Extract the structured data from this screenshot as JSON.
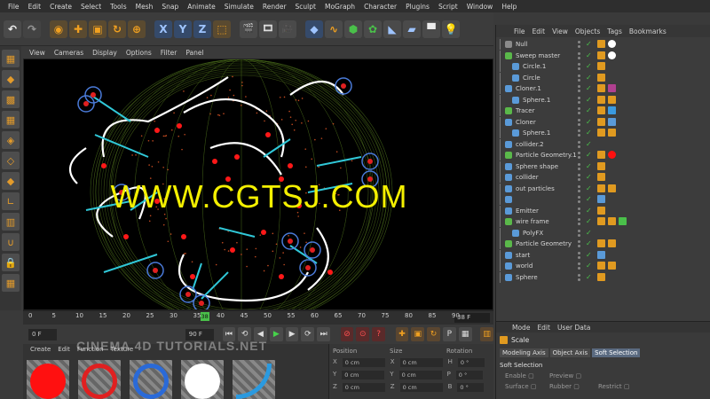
{
  "menubar": [
    "File",
    "Edit",
    "Create",
    "Select",
    "Tools",
    "Mesh",
    "Snap",
    "Animate",
    "Simulate",
    "Render",
    "Sculpt",
    "MoGraph",
    "Character",
    "Plugins",
    "Script",
    "Window",
    "Help"
  ],
  "toolbar": {
    "axes": [
      "X",
      "Y",
      "Z"
    ]
  },
  "viewport": {
    "menu": [
      "View",
      "Cameras",
      "Display",
      "Options",
      "Filter",
      "Panel"
    ],
    "watermark": "WWW.CGTSJ.COM"
  },
  "timeline": {
    "ticks": [
      "0",
      "5",
      "10",
      "15",
      "20",
      "25",
      "30",
      "35",
      "40",
      "45",
      "50",
      "55",
      "60",
      "65",
      "70",
      "75",
      "80",
      "85",
      "90"
    ],
    "current_frame": "38",
    "end_frame_label": "38 F"
  },
  "transport": {
    "start_field": "0 F",
    "end_field": "90 F"
  },
  "materials": {
    "menu": [
      "Create",
      "Edit",
      "Function",
      "Texture"
    ],
    "logo": "CINEMA 4D TUTORIALS.NET",
    "swatches": [
      {
        "color": "#ff1010",
        "style": "solid"
      },
      {
        "color": "#e02020",
        "style": "ring"
      },
      {
        "color": "#2a6ad8",
        "style": "ring"
      },
      {
        "color": "#ffffff",
        "style": "solid"
      },
      {
        "color": "#2a9ae0",
        "style": "curve"
      }
    ]
  },
  "coords": {
    "header": [
      "Position",
      "Size",
      "Rotation"
    ],
    "rows": [
      {
        "axis": "X",
        "pos": "0 cm",
        "size": "0 cm",
        "rot_label": "H",
        "rot": "0 °"
      },
      {
        "axis": "Y",
        "pos": "0 cm",
        "size": "0 cm",
        "rot_label": "P",
        "rot": "0 °"
      },
      {
        "axis": "Z",
        "pos": "0 cm",
        "size": "0 cm",
        "rot_label": "B",
        "rot": "0 °"
      }
    ]
  },
  "objects": {
    "menu": [
      "File",
      "Edit",
      "View",
      "Objects",
      "Tags",
      "Bookmarks"
    ],
    "rows": [
      {
        "name": "Null",
        "indent": 0,
        "icon": "#8a8a8a"
      },
      {
        "name": "Sweep master",
        "indent": 0,
        "icon": "#5ab84a"
      },
      {
        "name": "Circle.1",
        "indent": 1,
        "icon": "#5a9ad8"
      },
      {
        "name": "Circle",
        "indent": 1,
        "icon": "#5a9ad8"
      },
      {
        "name": "Cloner.1",
        "indent": 0,
        "icon": "#5a9ad8"
      },
      {
        "name": "Sphere.1",
        "indent": 1,
        "icon": "#5a9ad8"
      },
      {
        "name": "Tracer",
        "indent": 0,
        "icon": "#5ab84a"
      },
      {
        "name": "Cloner",
        "indent": 0,
        "icon": "#5a9ad8"
      },
      {
        "name": "Sphere.1",
        "indent": 1,
        "icon": "#5a9ad8"
      },
      {
        "name": "collider.2",
        "indent": 0,
        "icon": "#5a9ad8"
      },
      {
        "name": "Particle Geometry.1",
        "indent": 0,
        "icon": "#5ab84a"
      },
      {
        "name": "Sphere shape",
        "indent": 0,
        "icon": "#5a9ad8"
      },
      {
        "name": "collider",
        "indent": 0,
        "icon": "#5a9ad8"
      },
      {
        "name": "out particles",
        "indent": 0,
        "icon": "#5a9ad8"
      },
      {
        "name": "",
        "indent": 0,
        "icon": "#5a9ad8"
      },
      {
        "name": "Emitter",
        "indent": 0,
        "icon": "#5a9ad8"
      },
      {
        "name": "wire frame",
        "indent": 0,
        "icon": "#5ab84a"
      },
      {
        "name": "PolyFX",
        "indent": 1,
        "icon": "#5a9ad8"
      },
      {
        "name": "Particle Geometry",
        "indent": 0,
        "icon": "#5ab84a"
      },
      {
        "name": "start",
        "indent": 0,
        "icon": "#5a9ad8"
      },
      {
        "name": "world",
        "indent": 0,
        "icon": "#5a9ad8"
      },
      {
        "name": "Sphere",
        "indent": 0,
        "icon": "#5a9ad8"
      }
    ]
  },
  "attributes": {
    "menu": [
      "Mode",
      "Edit",
      "User Data"
    ],
    "title": "Scale",
    "tabs": [
      "Modeling Axis",
      "Object Axis",
      "Soft Selection"
    ],
    "active_tab": "Soft Selection",
    "section": "Soft Selection",
    "options": [
      "Enable",
      "Preview",
      "Surface",
      "Rubber",
      "Restrict"
    ]
  }
}
